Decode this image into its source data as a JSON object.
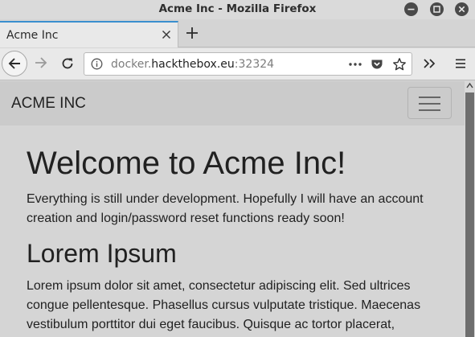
{
  "window": {
    "title": "Acme Inc - Mozilla Firefox"
  },
  "tabs": [
    {
      "label": "Acme Inc",
      "active": true
    }
  ],
  "address_bar": {
    "url_prefix": "docker.",
    "url_host": "hackthebox.eu",
    "url_suffix": ":32324"
  },
  "icons": {
    "minimize": "minimize-icon",
    "maximize": "maximize-icon",
    "close": "close-icon",
    "back": "back-arrow-icon",
    "forward": "forward-arrow-icon",
    "reload": "reload-icon",
    "info": "info-icon",
    "page_actions": "more-dots-icon",
    "pocket": "pocket-icon",
    "bookmark": "star-icon",
    "overflow": "overflow-chevron-icon",
    "menu": "hamburger-menu-icon"
  },
  "site": {
    "brand": "ACME INC",
    "heading": "Welcome to Acme Inc!",
    "intro": "Everything is still under development. Hopefully I will have an account creation and login/password reset functions ready soon!",
    "subheading": "Lorem Ipsum",
    "body": "Lorem ipsum dolor sit amet, consectetur adipiscing elit. Sed ultrices congue pellentesque. Phasellus cursus vulputate tristique. Maecenas vestibulum porttitor dui eget faucibus. Quisque ac tortor placerat,"
  },
  "colors": {
    "tab_accent": "#3a8fcf",
    "window_button": "#4a4a4a",
    "page_background": "#d5d5d5",
    "site_navbar": "#cbcbcb"
  }
}
